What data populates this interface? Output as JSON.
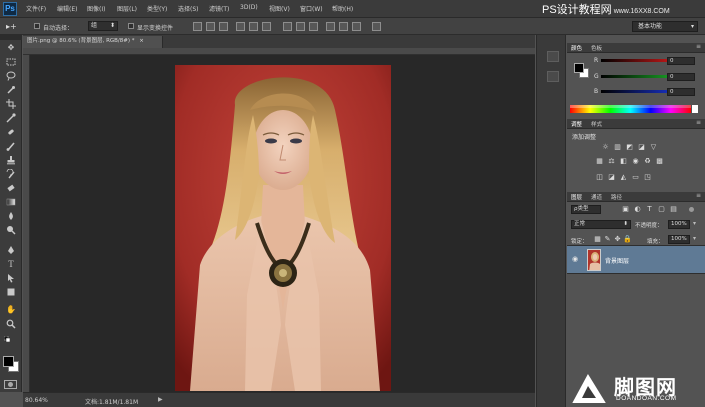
{
  "app": {
    "logo": "Ps"
  },
  "menu": [
    "文件(F)",
    "编辑(E)",
    "图像(I)",
    "图层(L)",
    "类型(Y)",
    "选择(S)",
    "滤镜(T)",
    "3D(D)",
    "视图(V)",
    "窗口(W)",
    "帮助(H)"
  ],
  "watermark_top": {
    "text": "PS设计教程网",
    "site": "www.16XX8.COM"
  },
  "window_controls": [
    "—",
    "□",
    "✕"
  ],
  "options_bar": {
    "auto_select_label": "自动选择：",
    "auto_select_value": "组",
    "show_transform_label": "显示变换控件",
    "workspace": "基本功能"
  },
  "tools": [
    "move-icon",
    "marquee-icon",
    "lasso-icon",
    "quick-select-icon",
    "crop-icon",
    "eyedropper-icon",
    "healing-icon",
    "brush-icon",
    "stamp-icon",
    "history-brush-icon",
    "eraser-icon",
    "gradient-icon",
    "blur-icon",
    "dodge-icon",
    "pen-icon",
    "type-icon",
    "path-select-icon",
    "shape-icon",
    "hand-icon",
    "zoom-icon"
  ],
  "document": {
    "tab_title": "图片.png @ 80.6% (背景图层, RGB/8#) *",
    "tab_close": "×"
  },
  "status": {
    "zoom": "80.64%",
    "doc_size": "文档:1.81M/1.81M",
    "arrow": "▶"
  },
  "color_panel": {
    "tabs": [
      "颜色",
      "色板"
    ],
    "channels": [
      {
        "label": "R",
        "value": "0",
        "color": "#d23030"
      },
      {
        "label": "G",
        "value": "0",
        "color": "#2fae3a"
      },
      {
        "label": "B",
        "value": "0",
        "color": "#2a3fd0"
      }
    ],
    "foreground": "#000000",
    "background": "#ffffff"
  },
  "adjust_panel": {
    "tabs": [
      "调整",
      "样式"
    ],
    "title": "添加调整"
  },
  "layers_panel": {
    "tabs": [
      "图层",
      "通道",
      "路径"
    ],
    "kind_label": "ρ类型",
    "blend_mode": "正常",
    "opacity_label": "不透明度：",
    "opacity_value": "100%",
    "lock_label": "锁定：",
    "fill_label": "填充：",
    "fill_value": "100%",
    "layer_name": "背景图层"
  },
  "watermark_bottom": {
    "title": "脚图网",
    "site": "DOANDOAN.COM"
  },
  "colors": {
    "accent": "#5f7a95",
    "panel_bg": "#535353",
    "canvas_bg": "#282828",
    "photo_bg": "#b2352c"
  }
}
